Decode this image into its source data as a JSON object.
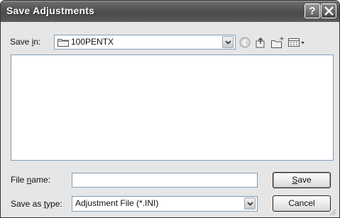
{
  "window": {
    "title": "Save Adjustments",
    "help_glyph": "?"
  },
  "save_in": {
    "label_pre": "Save ",
    "label_accel": "i",
    "label_post": "n:",
    "value": "100PENTX",
    "icon": "folder-icon"
  },
  "toolbar": {
    "icons": [
      "back-icon",
      "up-folder-icon",
      "new-folder-icon",
      "view-menu-icon"
    ]
  },
  "file_name": {
    "label_pre": "File ",
    "label_accel": "n",
    "label_post": "ame:",
    "value": ""
  },
  "save_as_type": {
    "label_pre": "Save as ",
    "label_accel": "t",
    "label_post": "ype:",
    "value": "Adjustment File (*.INI)"
  },
  "buttons": {
    "save_accel": "S",
    "save_rest": "ave",
    "cancel": "Cancel"
  }
}
